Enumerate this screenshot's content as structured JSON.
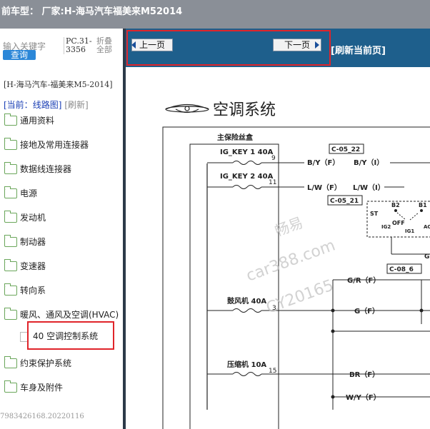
{
  "title_bar": {
    "text": "前车型：  厂家:H-海马汽车福美来M52014"
  },
  "sidebar": {
    "search": {
      "placeholder": "输入关键字",
      "button": "查询"
    },
    "pc_number": "PC.31-3356",
    "collapse": "折叠全部",
    "vehicle": "[H-海马汽车-福美来M5-2014]",
    "current_prefix": "[当前：",
    "current_link": "线路图]",
    "refresh": "[刷新]",
    "items": [
      {
        "label": "通用资料"
      },
      {
        "label": "接地及常用连接器"
      },
      {
        "label": "数据线连接器"
      },
      {
        "label": "电源"
      },
      {
        "label": "发动机"
      },
      {
        "label": "制动器"
      },
      {
        "label": "变速器"
      },
      {
        "label": "转向系"
      },
      {
        "label": "暖风、通风及空调(HVAC)"
      },
      {
        "label": "约束保护系统"
      },
      {
        "label": "车身及附件"
      }
    ],
    "subitem": {
      "label": "40 空调控制系统"
    },
    "footer_id": "7983426168.20220116"
  },
  "nav": {
    "prev": "上一页",
    "next": "下一页",
    "refresh_page": "[刷新当前页]"
  },
  "diagram": {
    "heading": "空调系统",
    "fuse_box_title": "主保险丝盒",
    "fuses": [
      {
        "name": "IG_KEY 1 40A",
        "pin": "9"
      },
      {
        "name": "IG_KEY 2 40A",
        "pin": "11"
      },
      {
        "name": "鼓风机 40A",
        "pin": "3"
      },
      {
        "name": "压缩机 10A",
        "pin": "15"
      }
    ],
    "connectors": [
      "C-05_22",
      "C-05_21",
      "C-08_6"
    ],
    "wires": [
      "B/Y（F）",
      "B/Y（I）",
      "L/W（F）",
      "L/W（I）",
      "G/R（F）",
      "G（F）",
      "BR（F）",
      "W/Y（F）"
    ],
    "switch_labels": [
      "ST",
      "B2",
      "B1",
      "OFF",
      "IG2",
      "IG1",
      "AC",
      "G"
    ],
    "watermark": [
      "畅易",
      "car388.com",
      "CY20165"
    ]
  },
  "colors": {
    "highlight": "#e0242a",
    "navbar": "#1e5f8c",
    "topbar": "#8a8f97"
  }
}
